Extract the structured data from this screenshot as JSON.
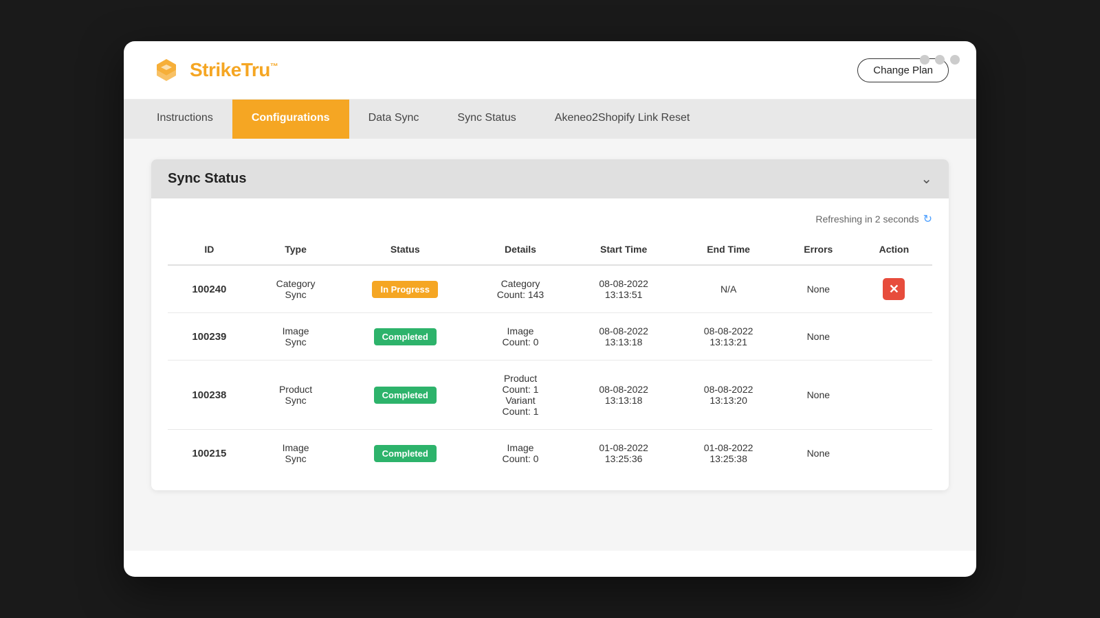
{
  "window": {
    "dots": [
      "dot1",
      "dot2",
      "dot3"
    ]
  },
  "logo": {
    "text_strike": "Strike",
    "text_tru": "Tru",
    "tm": "™"
  },
  "header": {
    "change_plan_label": "Change Plan"
  },
  "nav": {
    "items": [
      {
        "id": "instructions",
        "label": "Instructions",
        "active": false
      },
      {
        "id": "configurations",
        "label": "Configurations",
        "active": true
      },
      {
        "id": "data-sync",
        "label": "Data Sync",
        "active": false
      },
      {
        "id": "sync-status",
        "label": "Sync Status",
        "active": false
      },
      {
        "id": "akeneo-link",
        "label": "Akeneo2Shopify Link Reset",
        "active": false
      }
    ]
  },
  "sync_status_card": {
    "title": "Sync Status",
    "refresh_text": "Refreshing in 2 seconds",
    "chevron": "⌄",
    "table": {
      "headers": [
        "ID",
        "Type",
        "Status",
        "Details",
        "Start Time",
        "End Time",
        "Errors",
        "Action"
      ],
      "rows": [
        {
          "id": "100240",
          "type": "Category\nSync",
          "status": "In Progress",
          "status_type": "inprogress",
          "details": "Category\nCount: 143",
          "start_time": "08-08-2022\n13:13:51",
          "end_time": "N/A",
          "errors": "None",
          "has_action": true
        },
        {
          "id": "100239",
          "type": "Image\nSync",
          "status": "Completed",
          "status_type": "completed",
          "details": "Image\nCount: 0",
          "start_time": "08-08-2022\n13:13:18",
          "end_time": "08-08-2022\n13:13:21",
          "errors": "None",
          "has_action": false
        },
        {
          "id": "100238",
          "type": "Product\nSync",
          "status": "Completed",
          "status_type": "completed",
          "details": "Product\nCount: 1\nVariant\nCount: 1",
          "start_time": "08-08-2022\n13:13:18",
          "end_time": "08-08-2022\n13:13:20",
          "errors": "None",
          "has_action": false
        },
        {
          "id": "100215",
          "type": "Image\nSync",
          "status": "Completed",
          "status_type": "completed",
          "details": "Image\nCount: 0",
          "start_time": "01-08-2022\n13:25:36",
          "end_time": "01-08-2022\n13:25:38",
          "errors": "None",
          "has_action": false
        }
      ]
    }
  }
}
